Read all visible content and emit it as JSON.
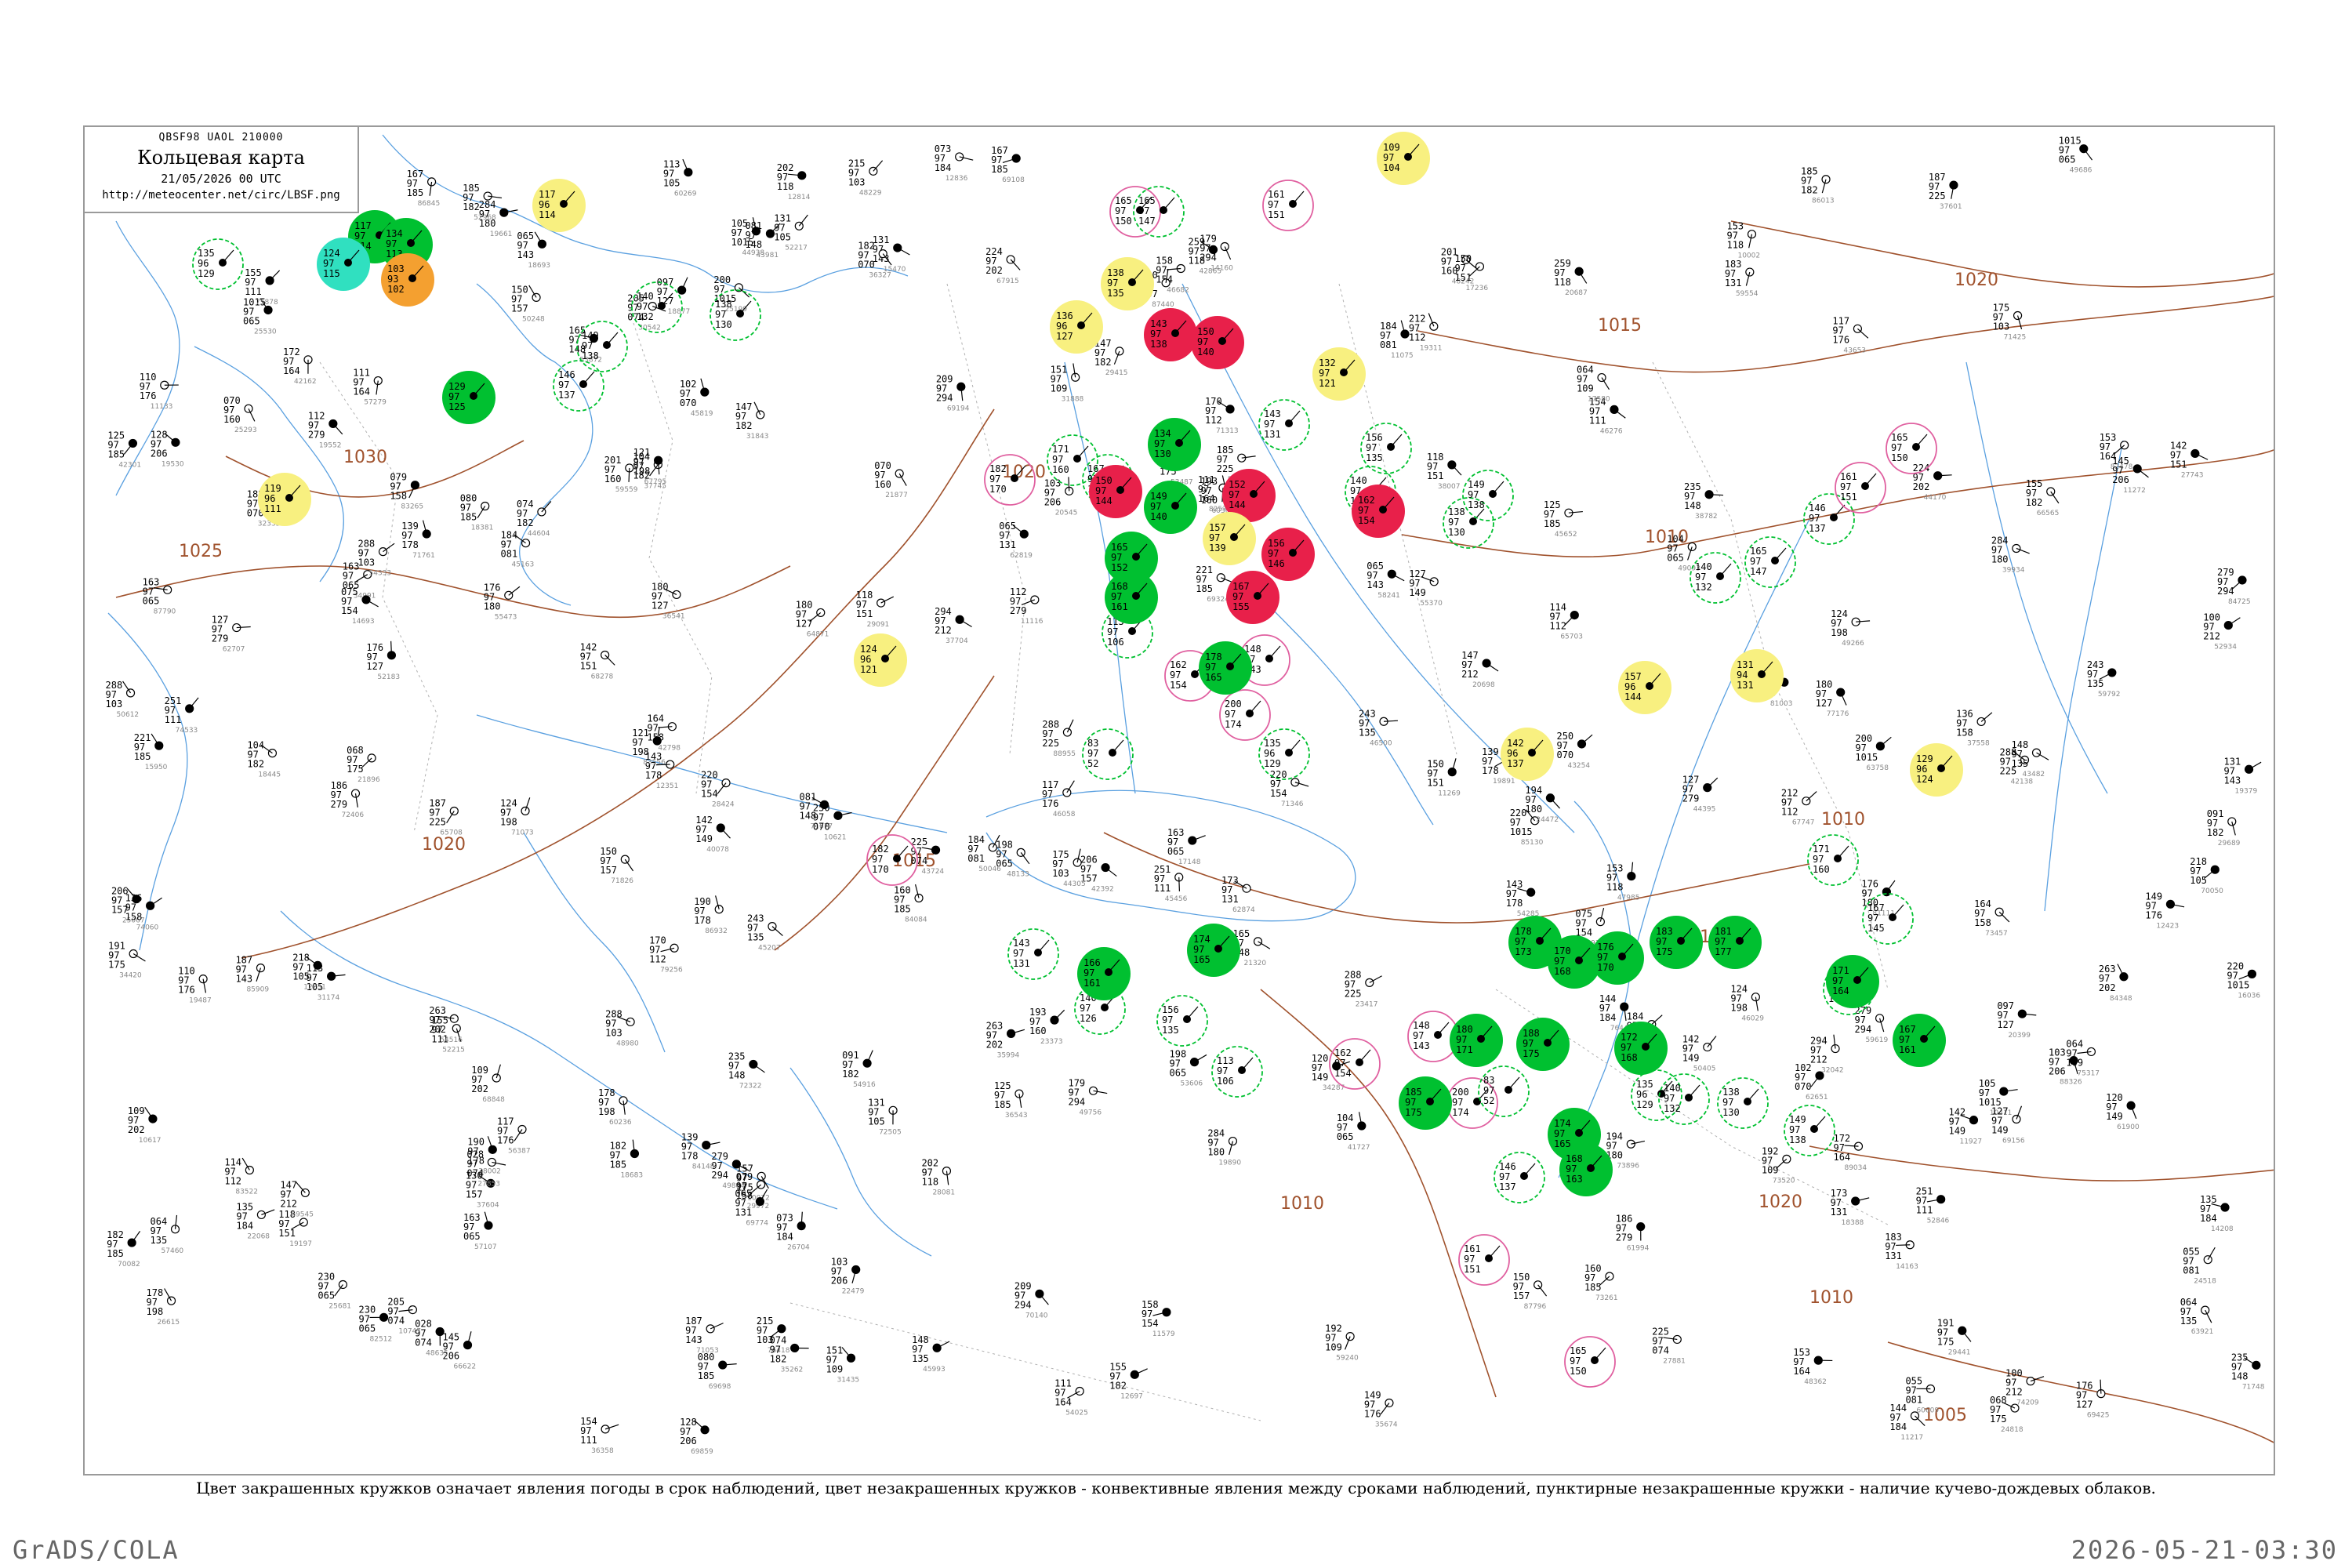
{
  "header": {
    "code": "QBSF98  UAOL  210000",
    "title": "Кольцевая карта",
    "time": "21/05/2026 00 UTC",
    "url": "http://meteocenter.net/circ/LBSF.png"
  },
  "caption": "Цвет закрашенных кружков означает явления погоды в срок наблюдений, цвет незакрашенных кружков - конвективные явления между сроками наблюдений, пунктирные незакрашенные кружки - наличие кучево-дождевых облаков.",
  "footer": {
    "left": "GrADS/COLA",
    "right": "2026-05-21-03:30"
  },
  "colors": {
    "green": "#00c030",
    "red": "#e8204a",
    "yellow": "#f8f080",
    "orange": "#f4a030",
    "cyan": "#30e0c0",
    "isobar": "#a0522d",
    "coast": "#5aa0e0",
    "pink": "#e060a0"
  },
  "isobars": [
    {
      "label": "1030"
    },
    {
      "label": "1025"
    },
    {
      "label": "1020"
    },
    {
      "label": "1015"
    },
    {
      "label": "1010"
    },
    {
      "label": "1005"
    }
  ],
  "filled_stations": [
    {
      "type": "green",
      "values": [
        "117",
        "97",
        "114"
      ]
    },
    {
      "type": "green",
      "values": [
        "134",
        "97",
        "113"
      ]
    },
    {
      "type": "cyan",
      "values": [
        "124",
        "97",
        "115"
      ]
    },
    {
      "type": "orange",
      "values": [
        "103",
        "93",
        "102"
      ]
    },
    {
      "type": "yellow",
      "values": [
        "117",
        "96",
        "114"
      ]
    },
    {
      "type": "green",
      "values": [
        "129",
        "97",
        "125"
      ]
    },
    {
      "type": "yellow",
      "values": [
        "119",
        "96",
        "111"
      ]
    },
    {
      "type": "yellow",
      "values": [
        "138",
        "97",
        "135"
      ]
    },
    {
      "type": "yellow",
      "values": [
        "136",
        "96",
        "127"
      ]
    },
    {
      "type": "red",
      "values": [
        "143",
        "97",
        "138"
      ]
    },
    {
      "type": "red",
      "values": [
        "150",
        "97",
        "140"
      ]
    },
    {
      "type": "yellow",
      "values": [
        "109",
        "97",
        "104"
      ]
    },
    {
      "type": "yellow",
      "values": [
        "132",
        "97",
        "121"
      ]
    },
    {
      "type": "green",
      "values": [
        "134",
        "97",
        "130"
      ]
    },
    {
      "type": "red",
      "values": [
        "150",
        "97",
        "144"
      ]
    },
    {
      "type": "red",
      "values": [
        "152",
        "97",
        "144"
      ]
    },
    {
      "type": "green",
      "values": [
        "149",
        "97",
        "140"
      ]
    },
    {
      "type": "yellow",
      "values": [
        "157",
        "97",
        "139"
      ]
    },
    {
      "type": "red",
      "values": [
        "156",
        "97",
        "146"
      ]
    },
    {
      "type": "red",
      "values": [
        "162",
        "97",
        "154"
      ]
    },
    {
      "type": "green",
      "values": [
        "165",
        "97",
        "152"
      ]
    },
    {
      "type": "red",
      "values": [
        "167",
        "97",
        "155"
      ]
    },
    {
      "type": "green",
      "values": [
        "168",
        "97",
        "161"
      ]
    },
    {
      "type": "yellow",
      "values": [
        "124",
        "96",
        "121"
      ]
    },
    {
      "type": "green",
      "values": [
        "178",
        "97",
        "165"
      ]
    },
    {
      "type": "yellow",
      "values": [
        "142",
        "96",
        "137"
      ]
    },
    {
      "type": "yellow",
      "values": [
        "157",
        "96",
        "144"
      ]
    },
    {
      "type": "yellow",
      "values": [
        "131",
        "94",
        "131"
      ]
    },
    {
      "type": "yellow",
      "values": [
        "129",
        "96",
        "124"
      ]
    },
    {
      "type": "green",
      "values": [
        "174",
        "97",
        "165"
      ]
    },
    {
      "type": "green",
      "values": [
        "178",
        "97",
        "173"
      ]
    },
    {
      "type": "green",
      "values": [
        "170",
        "97",
        "168"
      ]
    },
    {
      "type": "green",
      "values": [
        "176",
        "97",
        "170"
      ]
    },
    {
      "type": "green",
      "values": [
        "183",
        "97",
        "175"
      ]
    },
    {
      "type": "green",
      "values": [
        "181",
        "97",
        "177"
      ]
    },
    {
      "type": "green",
      "values": [
        "166",
        "97",
        "161"
      ]
    },
    {
      "type": "green",
      "values": [
        "171",
        "97",
        "164"
      ]
    },
    {
      "type": "green",
      "values": [
        "180",
        "97",
        "171"
      ]
    },
    {
      "type": "green",
      "values": [
        "188",
        "97",
        "175"
      ]
    },
    {
      "type": "green",
      "values": [
        "172",
        "97",
        "168"
      ]
    },
    {
      "type": "green",
      "values": [
        "167",
        "97",
        "161"
      ]
    },
    {
      "type": "green",
      "values": [
        "185",
        "97",
        "175"
      ]
    },
    {
      "type": "green",
      "values": [
        "174",
        "97",
        "165"
      ]
    },
    {
      "type": "green",
      "values": [
        "168",
        "97",
        "163"
      ]
    }
  ],
  "hollow_stations": [
    {
      "type": "green",
      "values": [
        "135",
        "96",
        "129"
      ]
    },
    {
      "type": "green",
      "values": [
        "140",
        "97",
        "132"
      ]
    },
    {
      "type": "green",
      "values": [
        "138",
        "97",
        "130"
      ]
    },
    {
      "type": "green",
      "values": [
        "149",
        "97",
        "138"
      ]
    },
    {
      "type": "green",
      "values": [
        "146",
        "97",
        "137"
      ]
    },
    {
      "type": "pink",
      "values": [
        "161",
        "97",
        "151"
      ]
    },
    {
      "type": "pink",
      "values": [
        "165",
        "97",
        "150"
      ]
    },
    {
      "type": "green",
      "values": [
        "165",
        "97",
        "147"
      ]
    },
    {
      "type": "green",
      "values": [
        "171",
        "97",
        "160"
      ]
    },
    {
      "type": "green",
      "values": [
        "167",
        "97",
        "145"
      ]
    },
    {
      "type": "pink",
      "values": [
        "182",
        "97",
        "170"
      ]
    },
    {
      "type": "green",
      "values": [
        "143",
        "97",
        "131"
      ]
    },
    {
      "type": "green",
      "values": [
        "140",
        "97",
        "126"
      ]
    },
    {
      "type": "green",
      "values": [
        "156",
        "97",
        "135"
      ]
    },
    {
      "type": "green",
      "values": [
        "113",
        "97",
        "106"
      ]
    },
    {
      "type": "pink",
      "values": [
        "162",
        "97",
        "154"
      ]
    },
    {
      "type": "pink",
      "values": [
        "148",
        "97",
        "143"
      ]
    },
    {
      "type": "pink",
      "values": [
        "200",
        "97",
        "174"
      ]
    },
    {
      "type": "green",
      "values": [
        "83",
        "97",
        "52"
      ]
    }
  ],
  "plain_values": [
    "251",
    "259",
    "279",
    "288",
    "284",
    "111",
    "125",
    "150",
    "118",
    "288",
    "124",
    "294",
    "263",
    "117",
    "103",
    "139",
    "142",
    "180",
    "235",
    "243",
    "164",
    "155",
    "144",
    "185",
    "183",
    "220",
    "157",
    "201",
    "167",
    "151",
    "131",
    "184",
    "225",
    "230",
    "250",
    "198",
    "220",
    "218",
    "212",
    "127",
    "155",
    "202",
    "209",
    "215",
    "176",
    "172",
    "221",
    "206",
    "142",
    "187",
    "178",
    "100",
    "224",
    "149",
    "145",
    "190",
    "127",
    "176",
    "165",
    "148",
    "136",
    "104",
    "135",
    "147",
    "173",
    "158",
    "191",
    "193",
    "182",
    "192",
    "187",
    "184",
    "205",
    "163",
    "182",
    "163",
    "200",
    "131",
    "170",
    "186",
    "154",
    "153",
    "179",
    "175",
    "194",
    "153",
    "160",
    "130",
    "150",
    "185",
    "121",
    "147",
    "109",
    "110",
    "128",
    "143",
    "120",
    "097",
    "081",
    "064",
    "079",
    "074",
    "073",
    "091",
    "065",
    "075",
    "068",
    "070",
    "080",
    "064",
    "065",
    "055",
    "028",
    "1015",
    "102",
    "104",
    "105",
    "113",
    "114",
    "112"
  ]
}
